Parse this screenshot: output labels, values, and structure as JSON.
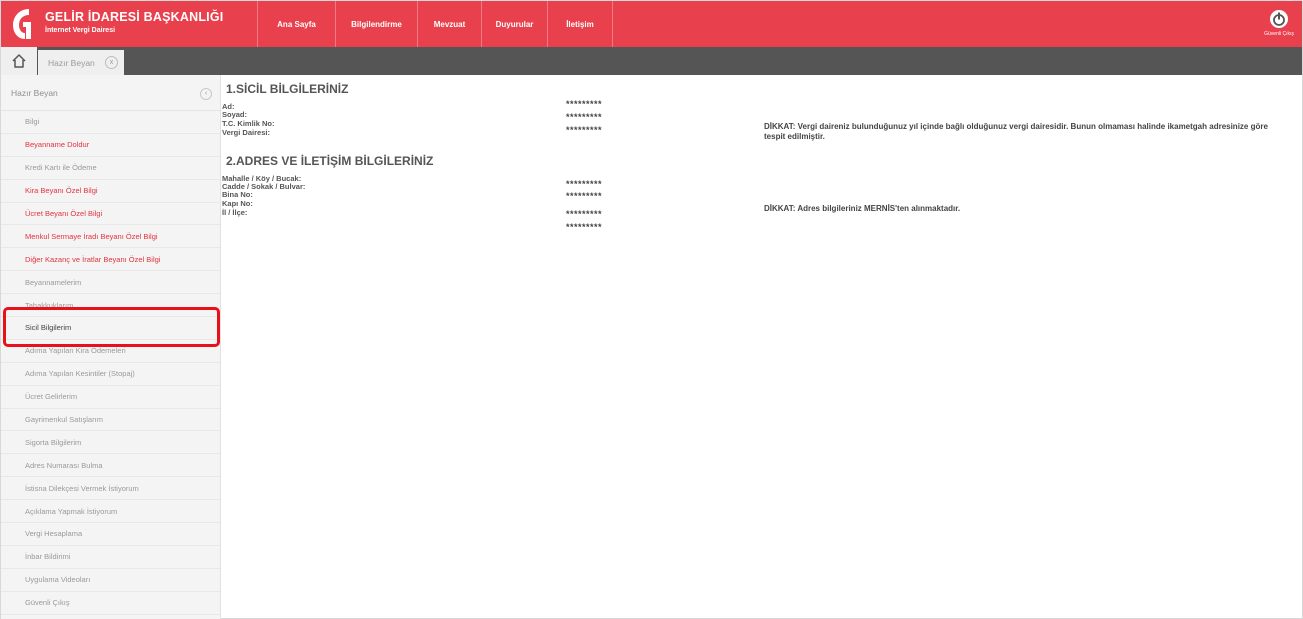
{
  "header": {
    "title": "GELİR İDARESİ BAŞKANLIĞI",
    "subtitle": "İnternet Vergi Dairesi",
    "brand_color": "#e8404d",
    "logo_icon": "gib-logo-icon",
    "nav": [
      "Ana Sayfa",
      "Bilgilendirme",
      "Mevzuat",
      "Duyurular",
      "İletişim"
    ],
    "logout_label": "Güvenli Çıkış"
  },
  "tabs": {
    "home_icon": "home-icon",
    "active_tab": "Hazır Beyan",
    "close_symbol": "x"
  },
  "sidebar": {
    "title": "Hazır Beyan",
    "collapse_symbol": "‹",
    "items": [
      {
        "label": "Bilgi",
        "color": "gray"
      },
      {
        "label": "Beyanname Doldur",
        "color": "red"
      },
      {
        "label": "Kredi Kartı ile Ödeme",
        "color": "gray"
      },
      {
        "label": "Kira Beyanı Özel Bilgi",
        "color": "red"
      },
      {
        "label": "Ücret Beyanı Özel Bilgi",
        "color": "red"
      },
      {
        "label": "Menkul Sermaye İradı Beyanı Özel Bilgi",
        "color": "red"
      },
      {
        "label": "Diğer Kazanç ve İratlar Beyanı Özel Bilgi",
        "color": "red"
      },
      {
        "label": "Beyannamelerim",
        "color": "gray"
      },
      {
        "label": "Tahakkuklarım",
        "color": "gray"
      },
      {
        "label": "Sicil Bilgilerim",
        "color": "active"
      },
      {
        "label": "Adıma Yapılan Kira Ödemeleri",
        "color": "gray"
      },
      {
        "label": "Adıma Yapılan Kesintiler (Stopaj)",
        "color": "gray"
      },
      {
        "label": "Ücret Gelirlerim",
        "color": "gray"
      },
      {
        "label": "Gayrimenkul Satışlarım",
        "color": "gray"
      },
      {
        "label": "Sigorta Bilgilerim",
        "color": "gray"
      },
      {
        "label": "Adres Numarası Bulma",
        "color": "gray"
      },
      {
        "label": "İstisna Dilekçesi Vermek İstiyorum",
        "color": "gray"
      },
      {
        "label": "Açıklama Yapmak İstiyorum",
        "color": "gray"
      },
      {
        "label": "Vergi Hesaplama",
        "color": "gray"
      },
      {
        "label": "İnbar Bildirimi",
        "color": "gray"
      },
      {
        "label": "Uygulama Videoları",
        "color": "gray"
      },
      {
        "label": "Güvenli Çıkış",
        "color": "gray"
      }
    ]
  },
  "sicil": {
    "title": "1.SİCİL BİLGİLERİNİZ",
    "fields": [
      {
        "label": "Ad:",
        "value": "*********"
      },
      {
        "label": "Soyad:",
        "value": "*********"
      },
      {
        "label": "T.C. Kimlik No:",
        "value": "*********"
      },
      {
        "label": "Vergi Dairesi:",
        "value": ""
      }
    ],
    "notice": "DİKKAT: Vergi daireniz bulunduğunuz yıl içinde bağlı olduğunuz vergi dairesidir. Bunun olmaması halinde ikametgah adresinize göre tespit edilmiştir."
  },
  "adres": {
    "title": "2.ADRES VE İLETİŞİM BİLGİLERİNİZ",
    "fields": [
      {
        "label": "Mahalle / Köy / Bucak:",
        "value": "*********"
      },
      {
        "label": "Cadde / Sokak / Bulvar:",
        "value": "*********"
      },
      {
        "label": "Bina No:",
        "value": ""
      },
      {
        "label": "Kapı No:",
        "value": "*********"
      },
      {
        "label": "İl / İlçe:",
        "value": "*********"
      }
    ],
    "notice": "DİKKAT: Adres bilgileriniz MERNİS'ten alınmaktadır."
  },
  "highlight_color": "#e8101c"
}
